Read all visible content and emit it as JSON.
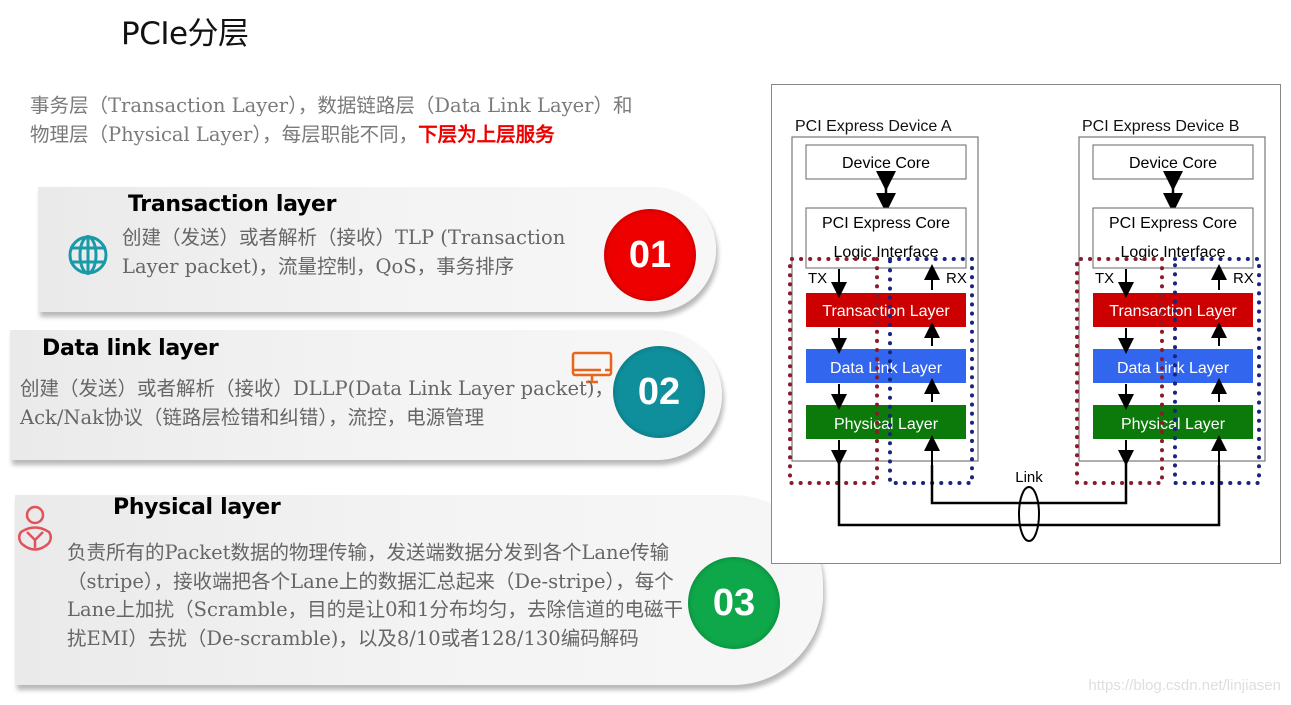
{
  "title": "PCIe分层",
  "intro": {
    "text": "事务层（Transaction Layer），数据链路层（Data Link Layer）和物理层（Physical Layer），每层职能不同，",
    "highlight": "下层为上层服务",
    "highlight_color": "#ee0000"
  },
  "layers": [
    {
      "title": "Transaction layer",
      "description": "创建（发送）或者解析（接收）TLP (Transaction Layer packet)，流量控制，QoS，事务排序",
      "badge": "01",
      "badge_color": "#ee0000",
      "icon": "globe-icon",
      "icon_color": "#1a9aa8"
    },
    {
      "title": "Data link layer",
      "description": "创建（发送）或者解析（接收）DLLP(Data Link Layer packet)，Ack/Nak协议（链路层检错和纠错），流控，电源管理",
      "badge": "02",
      "badge_color": "#0f8f9c",
      "icon": "monitor-icon",
      "icon_color": "#e8651a"
    },
    {
      "title": "Physical layer",
      "description": "负责所有的Packet数据的物理传输，发送端数据分发到各个Lane传输（stripe），接收端把各个Lane上的数据汇总起来（De-stripe），每个Lane上加扰（Scramble，目的是让0和1分布均匀，去除信道的电磁干扰EMI）去扰（De-scramble)，以及8/10或者128/130编码解码",
      "badge": "03",
      "badge_color": "#0ea84a",
      "icon": "user-icon",
      "icon_color": "#e2525a"
    }
  ],
  "diagram": {
    "devices": [
      {
        "label": "PCI Express Device A",
        "device_core": "Device Core",
        "core_interface_line1": "PCI Express Core",
        "core_interface_line2": "Logic Interface",
        "tx": "TX",
        "rx": "RX",
        "layers": [
          {
            "label": "Transaction Layer",
            "color": "#cc0000"
          },
          {
            "label": "Data Link Layer",
            "color": "#3366ee"
          },
          {
            "label": "Physical Layer",
            "color": "#0b7a0b"
          }
        ]
      },
      {
        "label": "PCI Express Device B",
        "device_core": "Device Core",
        "core_interface_line1": "PCI Express Core",
        "core_interface_line2": "Logic Interface",
        "tx": "TX",
        "rx": "RX",
        "layers": [
          {
            "label": "Transaction Layer",
            "color": "#cc0000"
          },
          {
            "label": "Data Link Layer",
            "color": "#3366ee"
          },
          {
            "label": "Physical Layer",
            "color": "#0b7a0b"
          }
        ]
      }
    ],
    "link_label": "Link",
    "tx_dot_color": "#8b1a2b",
    "rx_dot_color": "#1a237e"
  },
  "watermark": "https://blog.csdn.net/linjiasen"
}
